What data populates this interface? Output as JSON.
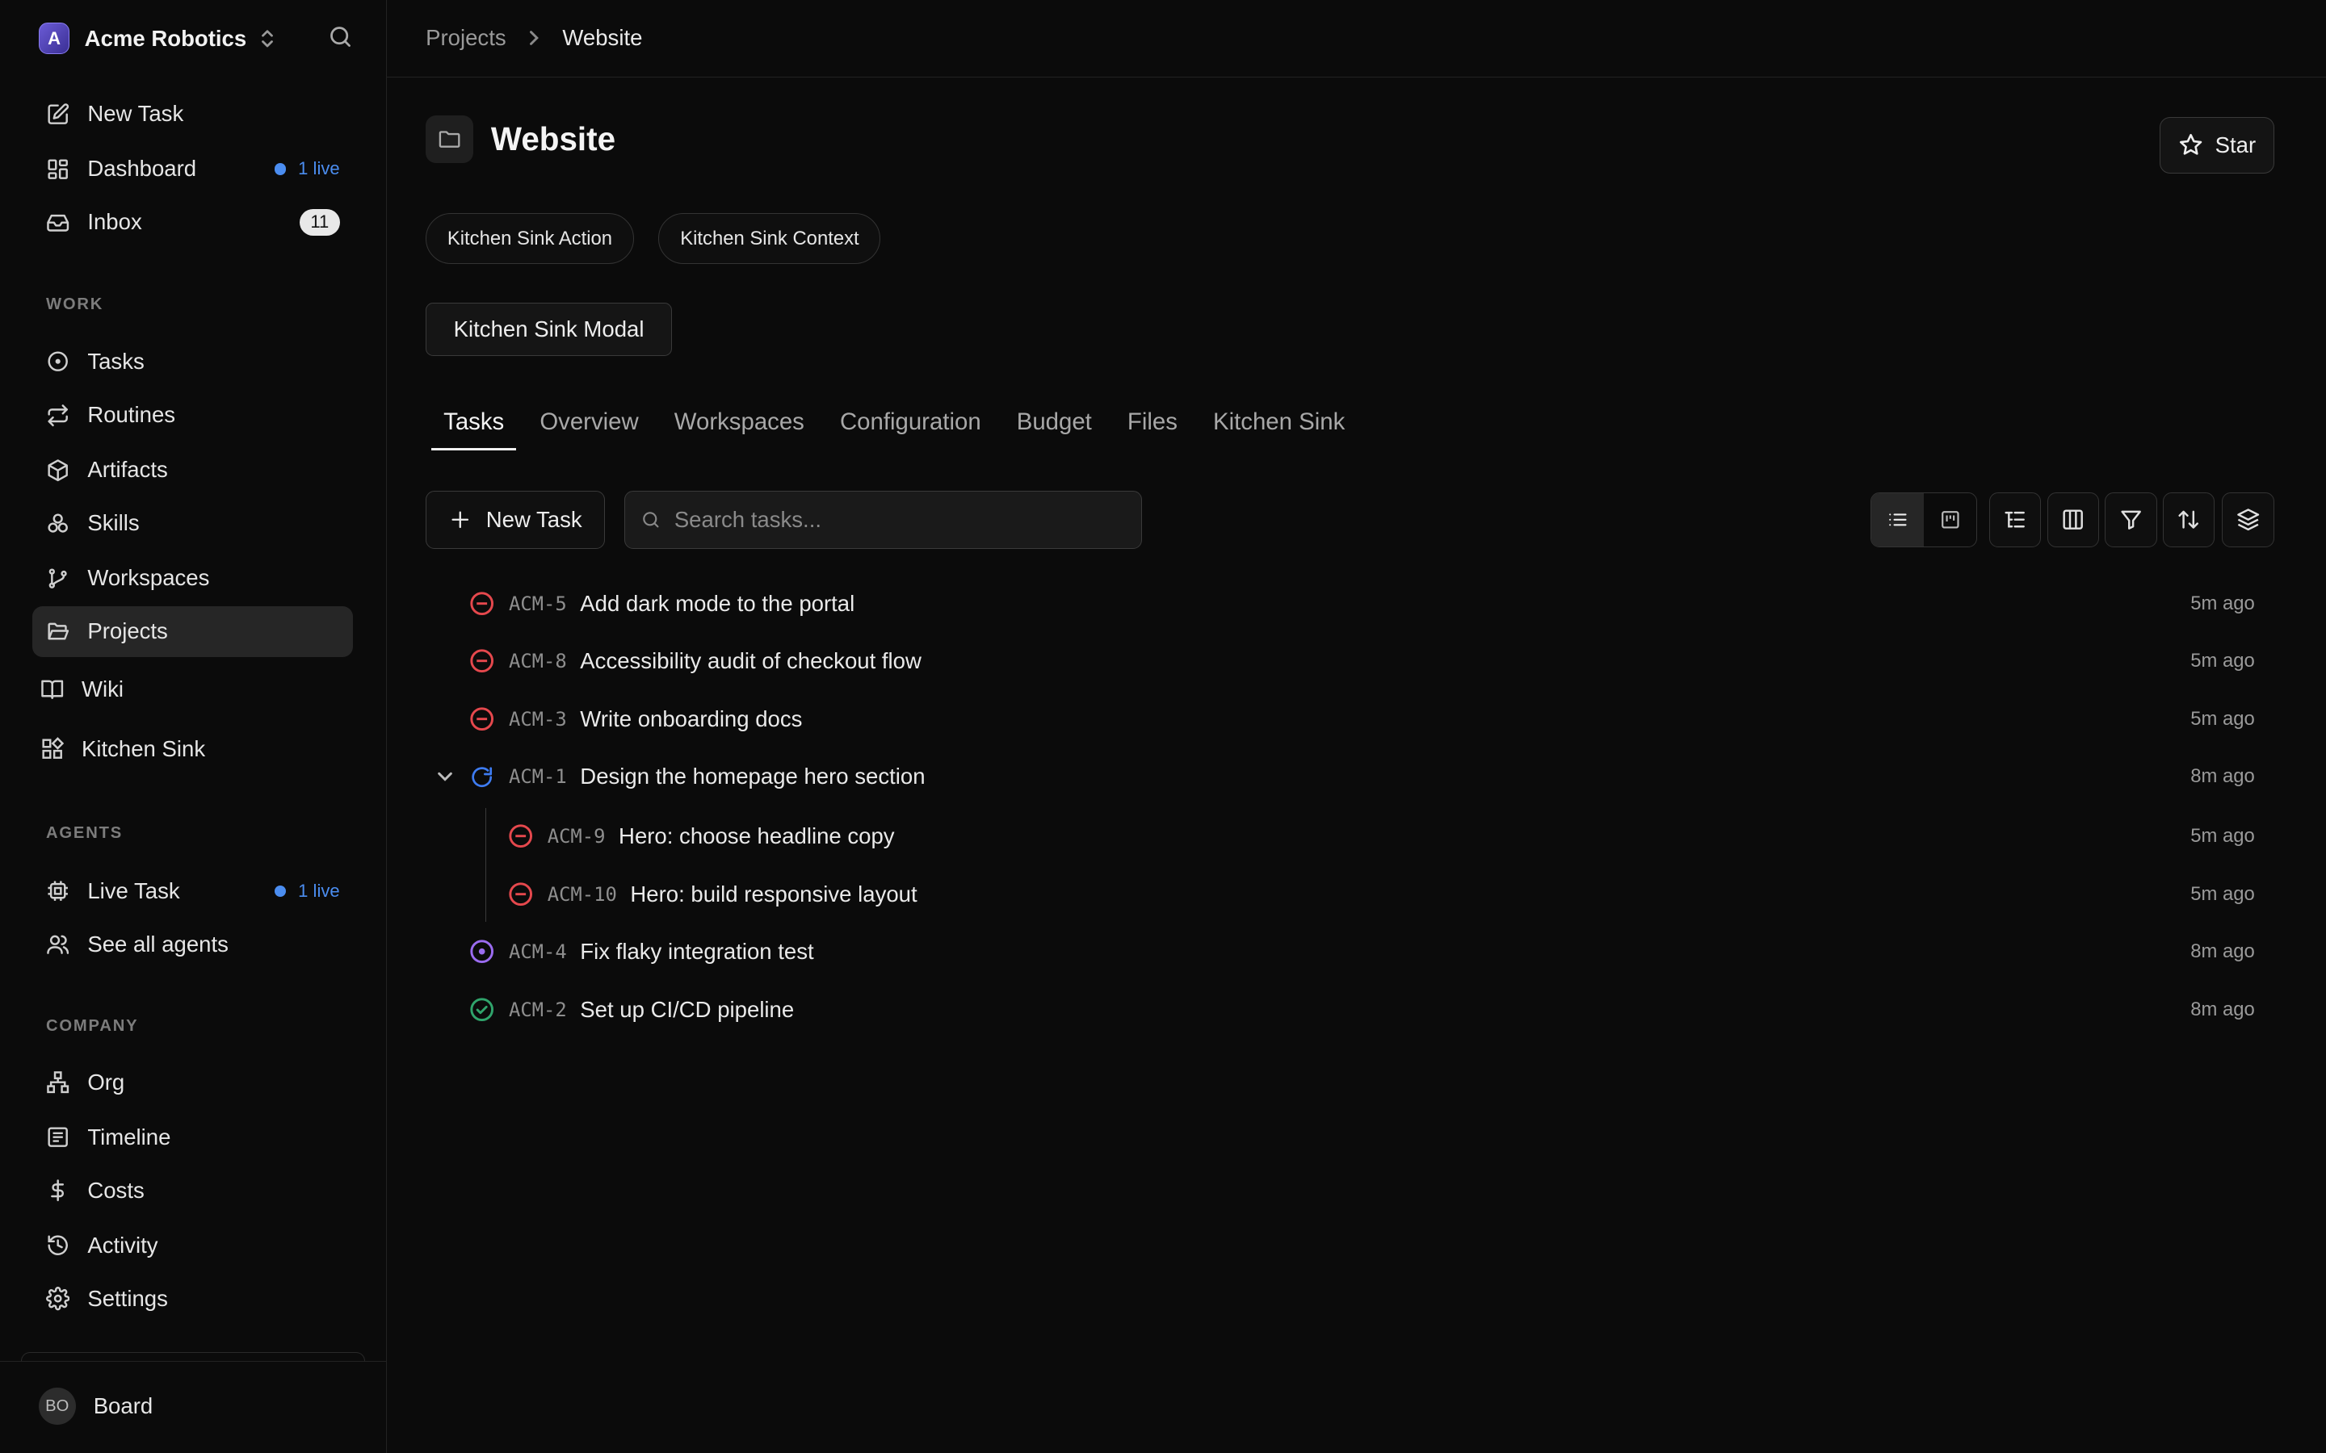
{
  "sidebar": {
    "brand": {
      "logo_letter": "A",
      "name": "Acme Robotics",
      "logo_color": "#5a4bc8"
    },
    "top_items": [
      {
        "label": "New Task",
        "icon": "edit-icon"
      },
      {
        "label": "Dashboard",
        "icon": "dashboard-icon",
        "live": "1 live"
      },
      {
        "label": "Inbox",
        "icon": "inbox-icon",
        "count": "11"
      }
    ],
    "sections": {
      "work": "WORK",
      "agents": "AGENTS",
      "company": "COMPANY"
    },
    "work_items": [
      {
        "label": "Tasks",
        "icon": "circle-dot-icon"
      },
      {
        "label": "Routines",
        "icon": "repeat-icon"
      },
      {
        "label": "Artifacts",
        "icon": "box-icon"
      },
      {
        "label": "Skills",
        "icon": "boxes-icon"
      },
      {
        "label": "Workspaces",
        "icon": "git-branch-icon"
      },
      {
        "label": "Projects",
        "icon": "folder-open-icon",
        "active": true
      },
      {
        "label": "Wiki",
        "icon": "book-icon"
      },
      {
        "label": "Kitchen Sink",
        "icon": "blocks-icon"
      }
    ],
    "agent_items": [
      {
        "label": "Live Task",
        "icon": "cpu-icon",
        "live": "1 live"
      },
      {
        "label": "See all agents",
        "icon": "users-icon"
      }
    ],
    "company_items": [
      {
        "label": "Org",
        "icon": "network-icon"
      },
      {
        "label": "Timeline",
        "icon": "list-icon"
      },
      {
        "label": "Costs",
        "icon": "dollar-icon"
      },
      {
        "label": "Activity",
        "icon": "history-icon"
      },
      {
        "label": "Settings",
        "icon": "gear-icon"
      }
    ],
    "user": {
      "initials": "BO",
      "name": "Board"
    },
    "live_color": "#4b8df0"
  },
  "breadcrumb": {
    "parent": "Projects",
    "current": "Website"
  },
  "header": {
    "title": "Website",
    "star_label": "Star"
  },
  "actions": {
    "pills": [
      "Kitchen Sink Action",
      "Kitchen Sink Context"
    ],
    "modal_label": "Kitchen Sink Modal"
  },
  "tabs": [
    "Tasks",
    "Overview",
    "Workspaces",
    "Configuration",
    "Budget",
    "Files",
    "Kitchen Sink"
  ],
  "toolbar": {
    "new_task_label": "New Task",
    "search_placeholder": "Search tasks..."
  },
  "status_colors": {
    "blocked": "#e5484d",
    "in_progress": "#3e7cf2",
    "todo": "#9b6cf0",
    "done": "#30a46c"
  },
  "tasks": [
    {
      "id": "ACM-5",
      "title": "Add dark mode to the portal",
      "time": "5m ago",
      "status": "blocked"
    },
    {
      "id": "ACM-8",
      "title": "Accessibility audit of checkout flow",
      "time": "5m ago",
      "status": "blocked"
    },
    {
      "id": "ACM-3",
      "title": "Write onboarding docs",
      "time": "5m ago",
      "status": "blocked"
    },
    {
      "id": "ACM-1",
      "title": "Design the homepage hero section",
      "time": "8m ago",
      "status": "in_progress"
    },
    {
      "id": "ACM-9",
      "title": "Hero: choose headline copy",
      "time": "5m ago",
      "status": "blocked"
    },
    {
      "id": "ACM-10",
      "title": "Hero: build responsive layout",
      "time": "5m ago",
      "status": "blocked"
    },
    {
      "id": "ACM-4",
      "title": "Fix flaky integration test",
      "time": "8m ago",
      "status": "todo"
    },
    {
      "id": "ACM-2",
      "title": "Set up CI/CD pipeline",
      "time": "8m ago",
      "status": "done"
    }
  ]
}
